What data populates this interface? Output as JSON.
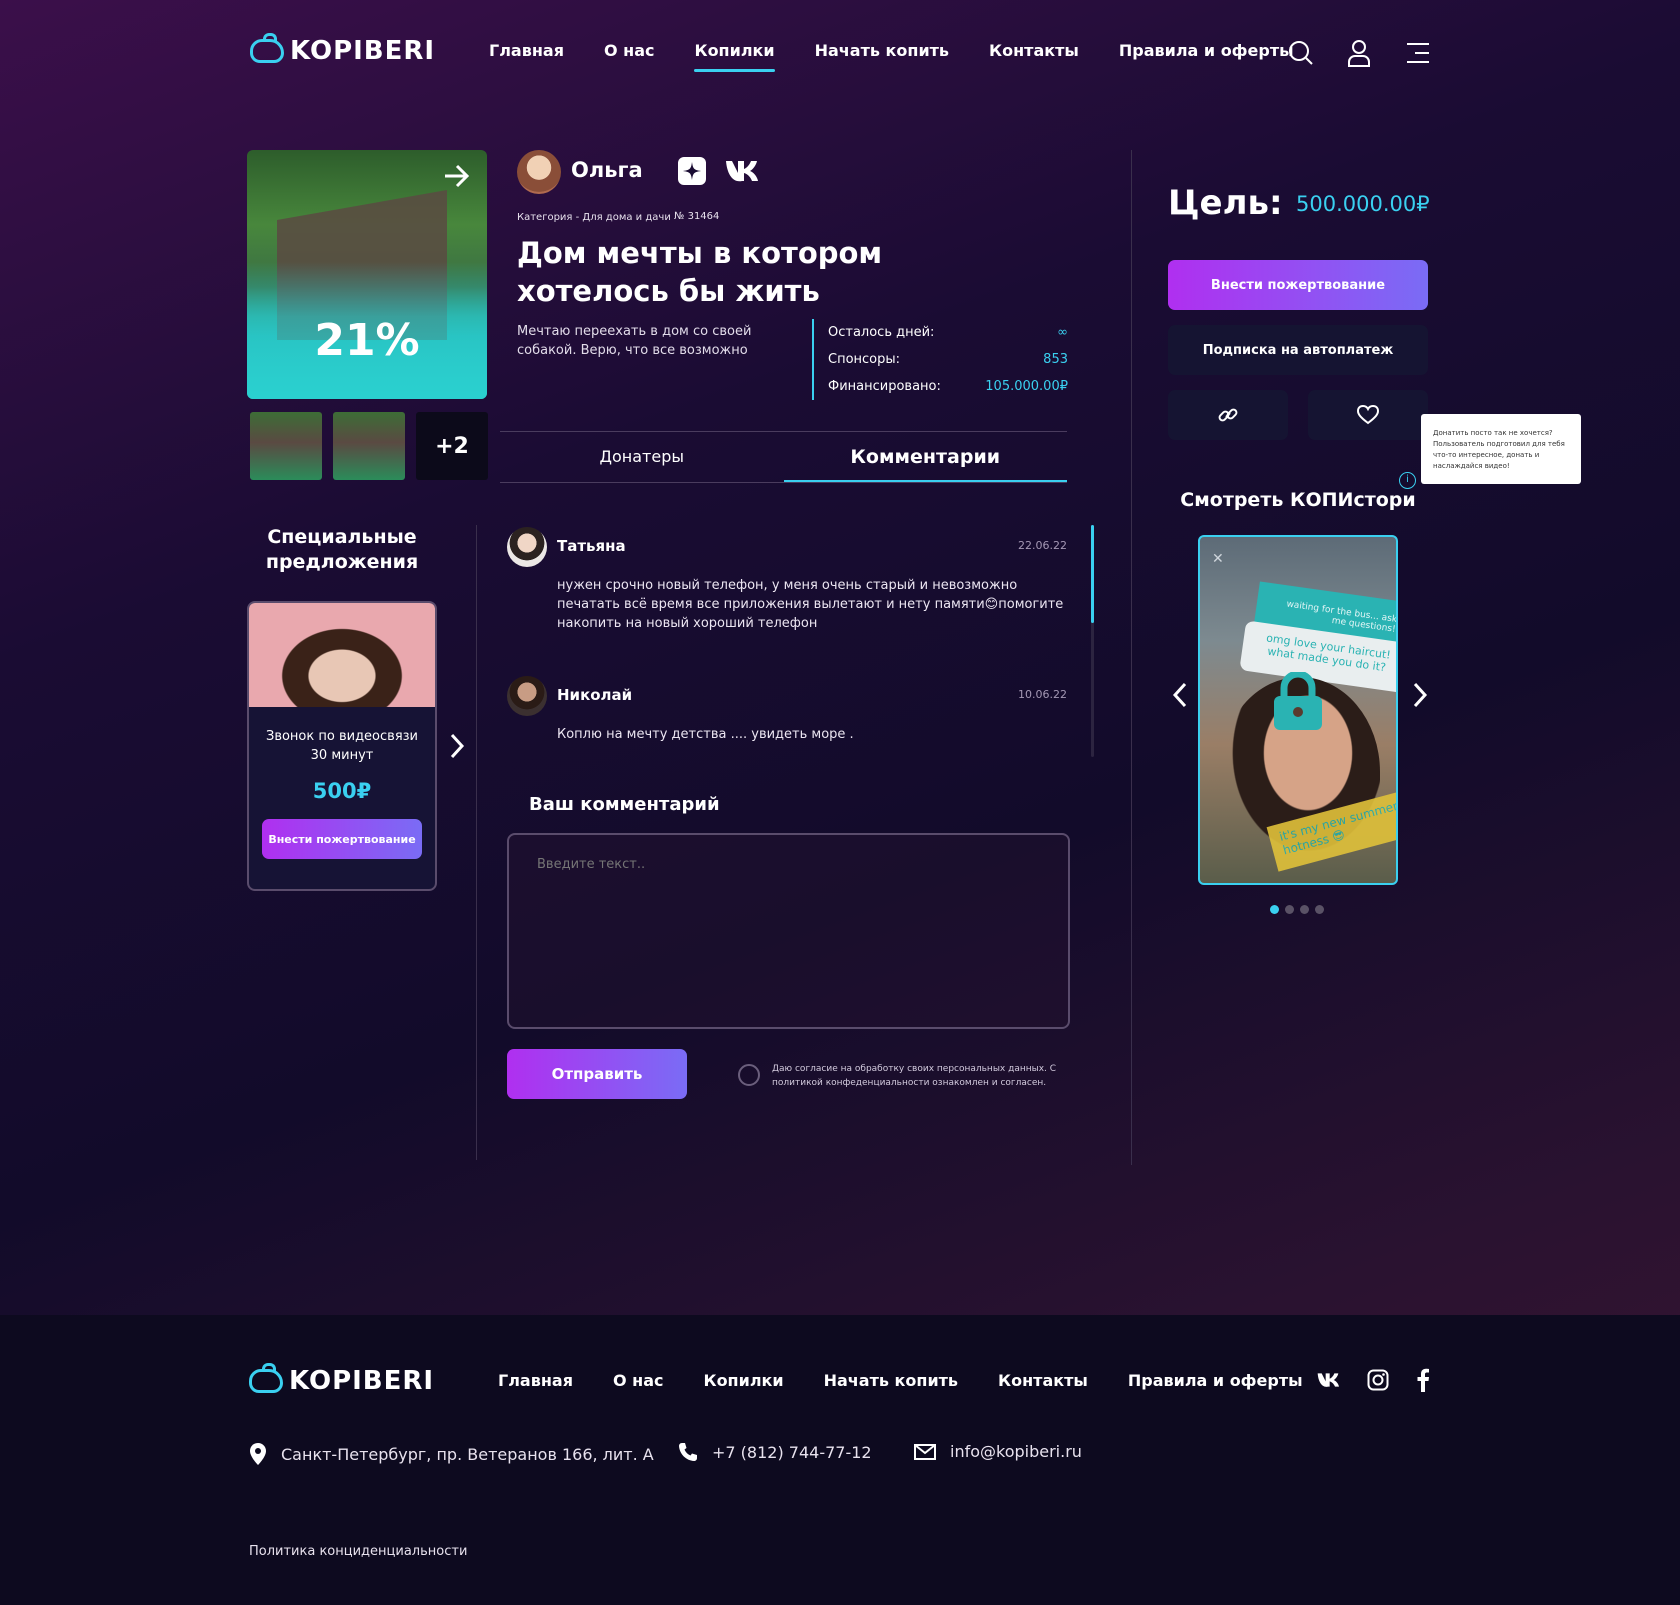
{
  "header": {
    "logo": "KOPIBERI",
    "nav": [
      "Главная",
      "О нас",
      "Копилки",
      "Начать копить",
      "Контакты",
      "Правила и оферты"
    ],
    "active_nav": "Копилки"
  },
  "campaign": {
    "progress_percent": "21%",
    "progress_value": 0.21,
    "extra_photos": "+2",
    "author": "Ольга",
    "category": "Категория - Для дома и дачи",
    "number": "№ 31464",
    "title": "Дом мечты в котором хотелось бы жить",
    "description": "Мечтаю переехать в дом со своей собакой. Верю, что все возможно",
    "stats": {
      "days_label": "Осталось дней:",
      "days_value": "∞",
      "sponsors_label": "Спонсоры:",
      "sponsors_value": "853",
      "funded_label": "Финансировано:",
      "funded_value": "105.000.00₽"
    }
  },
  "tabs": {
    "donors": "Донатеры",
    "comments": "Комментарии"
  },
  "comments": [
    {
      "name": "Татьяна",
      "date": "22.06.22",
      "text": "нужен срочно новый телефон, у меня очень старый и невозможно печатать всё время все приложения вылетают и нету памяти😊помогите накопить на новый хороший телефон"
    },
    {
      "name": "Николай",
      "date": "10.06.22",
      "text": "Коплю на мечту детства .... увидеть море ."
    }
  ],
  "comment_form": {
    "heading": "Ваш комментарий",
    "placeholder": "Введите текст..",
    "submit": "Отправить",
    "consent": "Даю согласие на обработку своих персональных данных. С политикой конфеденциальности ознакомлен и согласен."
  },
  "offers": {
    "heading": "Специальные предложения",
    "item_title": "Звонок по видеосвязи 30 минут",
    "item_price": "500₽",
    "item_button": "Внести пожертвование"
  },
  "goal": {
    "label": "Цель:",
    "value": "500.000.00₽",
    "donate_button": "Внести пожертвование",
    "subscribe_button": "Подписка на автоплатеж"
  },
  "stories": {
    "tooltip": "Донатить посто так не хочется? Пользователь подготовил для тебя что-то интересное, донать и наслаждайся видео!",
    "heading": "Смотреть КОПИстори",
    "story_text_1": "waiting for the bus... ask me questions!",
    "story_text_2": "omg love your haircut! what made you do it?",
    "story_text_3": "it's my new summer hotness 😎",
    "slides": 4,
    "active_slide": 1
  },
  "footer": {
    "logo": "KOPIBERI",
    "nav": [
      "Главная",
      "О нас",
      "Копилки",
      "Начать копить",
      "Контакты",
      "Правила и оферты"
    ],
    "address": "Санкт-Петербург, пр. Ветеранов 166, лит. А",
    "phone": "+7 (812) 744-77-12",
    "email": "info@kopiberi.ru",
    "privacy": "Политика конциденциальности"
  },
  "colors": {
    "accent": "#3ad0f0",
    "grad_start": "#b02ff0",
    "grad_end": "#7a6cf5"
  }
}
